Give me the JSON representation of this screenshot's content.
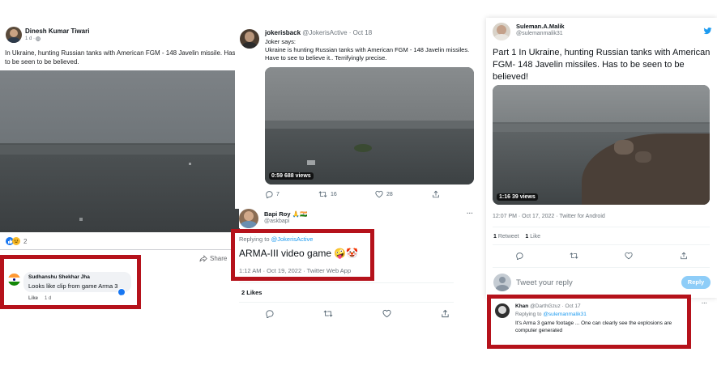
{
  "fb_post": {
    "author": "Dinesh Kumar Tiwari",
    "meta": "1 d · ",
    "text": "In Ukraine, hunting Russian tanks with American FGM - 148 Javelin missile. Has to be seen to be believed.",
    "reaction_count": "2",
    "share_label": "Share",
    "comment": {
      "author": "Sudhanshu Shekhar Jha",
      "text": "Looks like clip from game Arma 3",
      "like_label": "Like",
      "age": "1 d"
    }
  },
  "tweet_joker": {
    "name": "jokerisback",
    "handle": "@JokerisActive",
    "date": "· Oct 18",
    "text": "Joker says:\nUkraine is hunting Russian tanks with American FGM - 148 Javelin missiles. Have to see to believe it.. Terrifyingly precise.",
    "video_time": "0:59",
    "video_views": "688 views",
    "reply_count": "7",
    "retweet_count": "16",
    "like_count": "28"
  },
  "tweet_bapi": {
    "name": "Bapi Roy",
    "flags": "🙏🇮🇳",
    "handle": "@askbapi",
    "more": "···",
    "replying_prefix": "Replying to ",
    "replying_handle": "@JokerisActive",
    "text": "ARMA-III video game 🤪🤡",
    "timestamp": "1:12 AM · Oct 19, 2022 · Twitter Web App",
    "likes": "2 Likes"
  },
  "tweet_suleman": {
    "name": "Suleman.A.Malik",
    "handle": "@sulemanmalik31",
    "text": "Part 1 In Ukraine, hunting Russian tanks with American FGM- 148 Javelin missiles. Has to be seen to be believed!",
    "video_time": "1:16",
    "video_views": "39 views",
    "timestamp": "12:07 PM · Oct 17, 2022 · Twitter for Android",
    "retweets_num": "1",
    "retweets_label": "Retweet",
    "likes_num": "1",
    "likes_label": "Like",
    "reply_placeholder": "Tweet your reply",
    "reply_button": "Reply",
    "more": "···"
  },
  "tweet_khan": {
    "name": "Khan",
    "handle": "@DarthGzuz",
    "date": "· Oct 17",
    "replying_prefix": "Replying to ",
    "replying_handle": "@sulemanmalik31",
    "text": "It's Arma 3 game footage ... One can clearly see the explosions are computer generated",
    "more": "···"
  },
  "colors": {
    "highlight_border": "#b5121b",
    "twitter_blue": "#1d9bf0",
    "muted": "#6e767d",
    "fb_blue": "#1877f2"
  },
  "icons": [
    "globe-icon",
    "like-icon",
    "haha-icon",
    "share-icon",
    "reply-icon",
    "retweet-icon",
    "heart-icon",
    "upload-icon",
    "more-icon",
    "india-flag-icon"
  ]
}
